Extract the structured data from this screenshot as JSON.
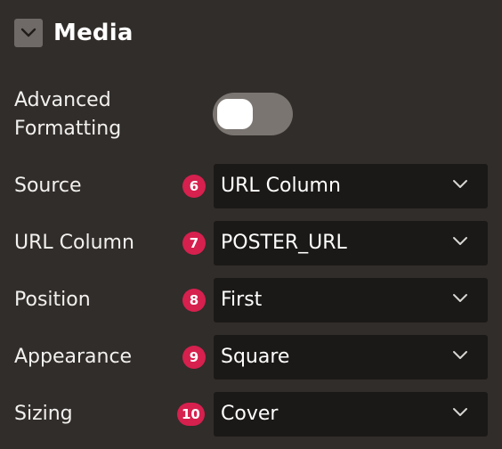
{
  "section": {
    "title": "Media"
  },
  "fields": {
    "advanced_formatting": {
      "label_line1": "Advanced",
      "label_line2": "Formatting",
      "enabled": false
    },
    "source": {
      "label": "Source",
      "badge": "6",
      "value": "URL Column"
    },
    "url_column": {
      "label": "URL Column",
      "badge": "7",
      "value": "POSTER_URL"
    },
    "position": {
      "label": "Position",
      "badge": "8",
      "value": "First"
    },
    "appearance": {
      "label": "Appearance",
      "badge": "9",
      "value": "Square"
    },
    "sizing": {
      "label": "Sizing",
      "badge": "10",
      "value": "Cover"
    }
  },
  "colors": {
    "background": "#312d2a",
    "badge": "#d6204e",
    "select_background": "#1b1917",
    "toggle_off": "#7a7571"
  }
}
